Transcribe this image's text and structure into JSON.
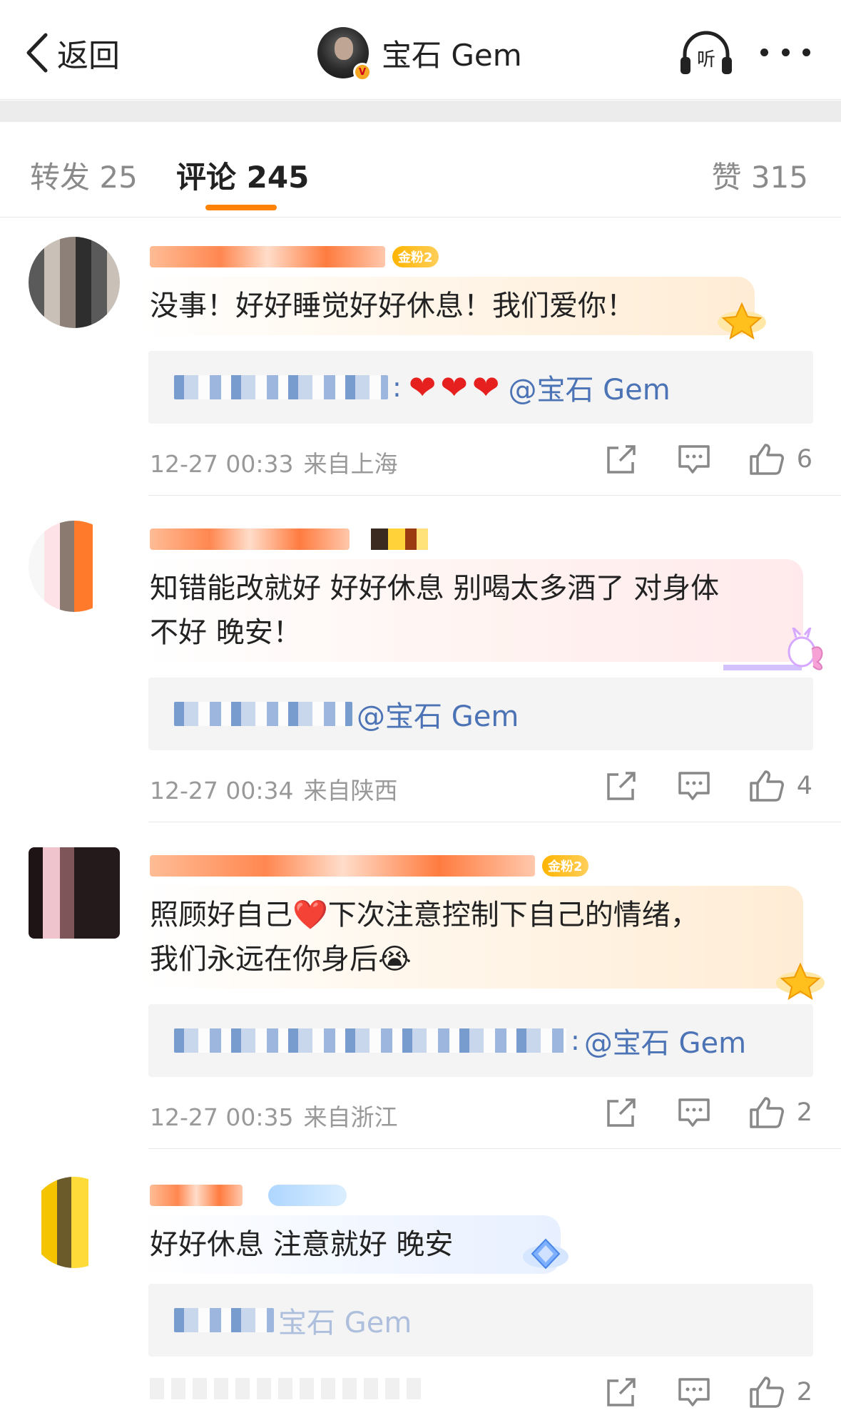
{
  "nav": {
    "back_label": "返回",
    "title": "宝石 Gem",
    "listen_label": "听"
  },
  "tabs": [
    {
      "label": "转发 25",
      "active": false
    },
    {
      "label": "评论 245",
      "active": true
    },
    {
      "label": "赞 315",
      "active": false
    }
  ],
  "colors": {
    "accent": "#ff8200",
    "link": "#4b73b5",
    "heart": "#e5201f",
    "meta_text": "#999999"
  },
  "comments": [
    {
      "fan_badge": "金粉2",
      "text": "没事！好好睡觉好好休息！我们爱你！",
      "reply_hearts": "❤️❤️❤️",
      "reply_mention": "@宝石 Gem",
      "time": "12-27 00:33",
      "location": "来自上海",
      "likes": "6"
    },
    {
      "fan_badge": "",
      "text_line1": "知错能改就好 好好休息 别喝太多酒了 对身体",
      "text_line2": "不好 晚安！",
      "reply_mention": "@宝石 Gem",
      "time": "12-27 00:34",
      "location": "来自陕西",
      "likes": "4"
    },
    {
      "fan_badge": "金粉2",
      "text_line1": "照顾好自己❤️下次注意控制下自己的情绪，",
      "text_line2": "我们永远在你身后😭",
      "reply_mention": "@宝石 Gem",
      "time": "12-27 00:35",
      "location": "来自浙江",
      "likes": "2"
    },
    {
      "fan_badge": "",
      "text": "好好休息 注意就好 晚安",
      "reply_mention": "宝石 Gem",
      "likes": "2"
    }
  ],
  "icons": [
    "back-chevron-icon",
    "verified-v-icon",
    "listen-headphones-icon",
    "more-dots-icon",
    "share-icon",
    "comment-icon",
    "like-thumb-icon"
  ]
}
